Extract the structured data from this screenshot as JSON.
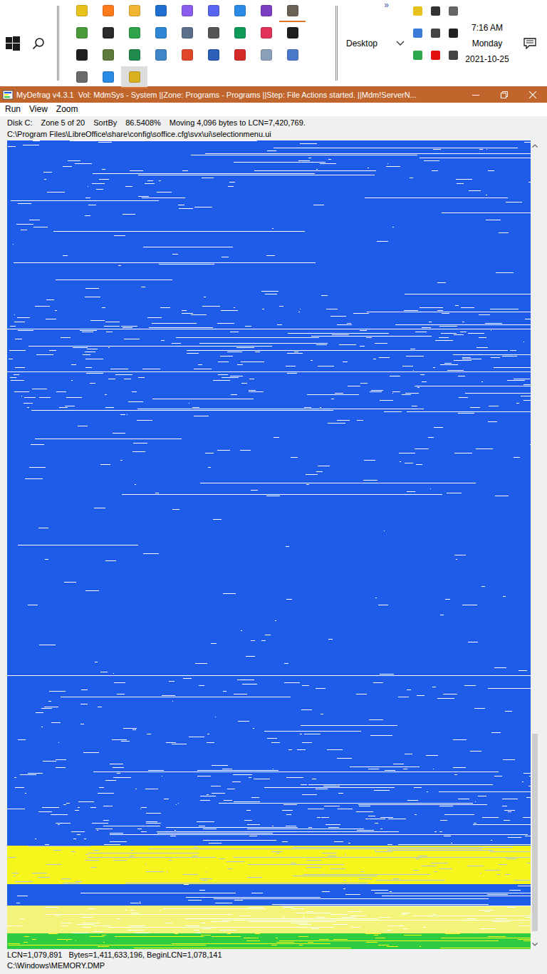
{
  "taskbar": {
    "pinned_apps": [
      {
        "color": "#e8c21c",
        "running": false,
        "active": false
      },
      {
        "color": "#ff7a1c",
        "running": false,
        "active": false
      },
      {
        "color": "#f2b634",
        "running": false,
        "active": false
      },
      {
        "color": "#1f6fd1",
        "running": false,
        "active": false
      },
      {
        "color": "#8a5cf0",
        "running": false,
        "active": false
      },
      {
        "color": "#5865f2",
        "running": false,
        "active": false
      },
      {
        "color": "#2a8ae6",
        "running": false,
        "active": false
      },
      {
        "color": "#7b3fc4",
        "running": false,
        "active": false
      },
      {
        "color": "#6b6255",
        "running": true,
        "active": false
      },
      {
        "color": "#4a9a3a",
        "running": false,
        "active": false
      },
      {
        "color": "#2b2b2b",
        "running": false,
        "active": false
      },
      {
        "color": "#2fa34a",
        "running": false,
        "active": false
      },
      {
        "color": "#2f86d6",
        "running": false,
        "active": false
      },
      {
        "color": "#5a6f8c",
        "running": false,
        "active": false
      },
      {
        "color": "#555555",
        "running": false,
        "active": false
      },
      {
        "color": "#0f9a5a",
        "running": false,
        "active": false
      },
      {
        "color": "#e0315a",
        "running": false,
        "active": false
      },
      {
        "color": "#1e1e1e",
        "running": false,
        "active": false
      },
      {
        "color": "#1e1e1e",
        "running": false,
        "active": false
      },
      {
        "color": "#5d7a3a",
        "running": false,
        "active": false
      },
      {
        "color": "#1f8a4c",
        "running": false,
        "active": false
      },
      {
        "color": "#3f86c8",
        "running": false,
        "active": false
      },
      {
        "color": "#e0472a",
        "running": false,
        "active": false
      },
      {
        "color": "#2b5fb8",
        "running": false,
        "active": false
      },
      {
        "color": "#d42a2a",
        "running": false,
        "active": false
      },
      {
        "color": "#8aa0b8",
        "running": false,
        "active": false
      },
      {
        "color": "#4a78c8",
        "running": false,
        "active": false
      },
      {
        "color": "#6a6a6a",
        "running": false,
        "active": false
      },
      {
        "color": "#2a8ae6",
        "running": false,
        "active": false
      },
      {
        "color": "#d8b020",
        "running": true,
        "active": true
      }
    ],
    "overflow": "»",
    "toolbar_label": "Desktop",
    "tray_icons": [
      {
        "color": "#e8c21c"
      },
      {
        "color": "#333333"
      },
      {
        "color": "#666666"
      },
      {
        "color": "#3a7ad8"
      },
      {
        "color": "#444444"
      },
      {
        "color": "#222222"
      },
      {
        "color": "#2aa84a"
      },
      {
        "color": "#e01010"
      },
      {
        "color": "#444444"
      }
    ],
    "clock": {
      "time": "7:16 AM",
      "day": "Monday",
      "date": "2021-10-25"
    }
  },
  "window": {
    "title": "MyDefrag v4.3.1  Vol: MdmSys - System ||Zone: Programs - Programs ||Step: File Actions started. ||Mdm!ServerN...",
    "active": true
  },
  "menu": [
    "Run",
    "View",
    "Zoom"
  ],
  "status": {
    "disk": "Disk C:",
    "zone": "Zone 5 of 20",
    "sort": "SortBy",
    "progress": "86.5408%",
    "action": "Moving 4,096 bytes to LCN=7,420,769.",
    "file": "C:\\Program Files\\LibreOffice\\share\\config\\soffice.cfg\\svx\\ui\\selectionmenu.ui"
  },
  "disk_map": {
    "segments": [
      {
        "color": "#1e5be8",
        "speck": "#ffffff",
        "density": 0.12,
        "share": 0.08
      },
      {
        "color": "#1e5be8",
        "speck": "#ffffff",
        "density": 0.05,
        "share": 0.125
      },
      {
        "color": "#1e5be8",
        "speck": "#ffffff",
        "density": 0.3,
        "share": 0.13
      },
      {
        "color": "#1e5be8",
        "speck": "#ffffff",
        "density": 0.08,
        "share": 0.105
      },
      {
        "color": "#1e5be8",
        "speck": "#ffffff",
        "density": 0.03,
        "share": 0.22
      },
      {
        "color": "#1e5be8",
        "speck": "#ffffff",
        "density": 0.12,
        "share": 0.115
      },
      {
        "color": "#1e5be8",
        "speck": "#ffffff",
        "density": 0.35,
        "share": 0.097
      },
      {
        "color": "#f6f61c",
        "speck": "#b4c4e8",
        "density": 0.4,
        "share": 0.048
      },
      {
        "color": "#1e5be8",
        "speck": "#ffffff",
        "density": 0.2,
        "share": 0.026
      },
      {
        "color": "#f4f47a",
        "speck": "#ffffff",
        "density": 0.5,
        "share": 0.035
      },
      {
        "color": "#2ecc40",
        "speck": "#f6f61c",
        "density": 0.5,
        "share": 0.019
      }
    ]
  },
  "scrollbar": {
    "offset": 0.74,
    "visible": 0.25
  },
  "footer": {
    "cluster": "LCN=1,079,891   Bytes=1,411,633,196, BeginLCN=1,078,141",
    "file": "C:\\Windows\\MEMORY.DMP"
  }
}
